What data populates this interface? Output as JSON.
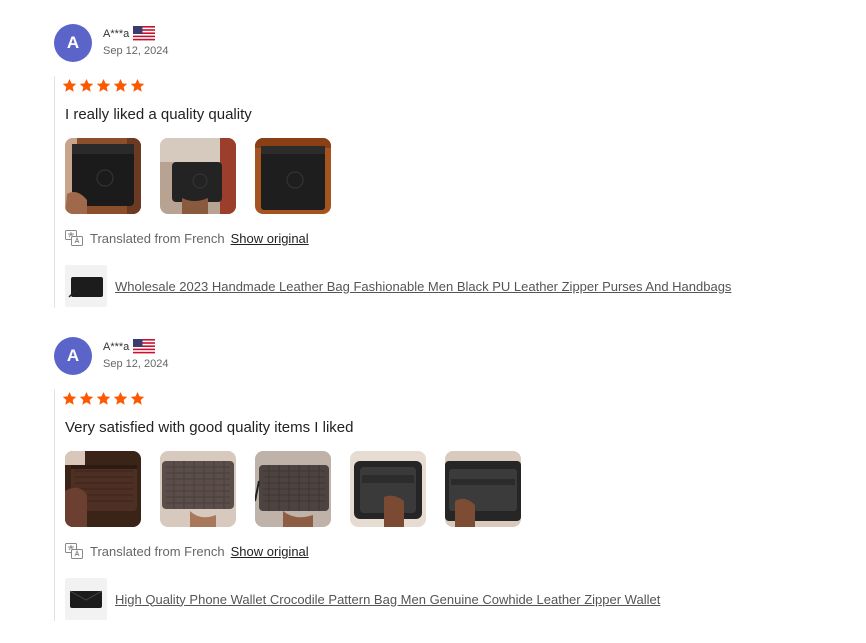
{
  "reviews": [
    {
      "avatar_letter": "A",
      "username": "A***a",
      "date": "Sep 12, 2024",
      "rating": 5,
      "text": "I really liked a quality quality",
      "translated_label": "Translated from French",
      "show_original_label": "Show original",
      "product_title": "Wholesale 2023 Handmade Leather Bag Fashionable Men Black PU Leather Zipper Purses And Handbags",
      "photo_count": 3
    },
    {
      "avatar_letter": "A",
      "username": "A***a",
      "date": "Sep 12, 2024",
      "rating": 5,
      "text": "Very satisfied with good quality items I liked",
      "translated_label": "Translated from French",
      "show_original_label": "Show original",
      "product_title": "High Quality Phone Wallet Crocodile Pattern Bag Men Genuine Cowhide Leather Zipper Wallet",
      "photo_count": 5
    }
  ],
  "colors": {
    "avatar": "#5b64c9",
    "star": "#fd5a00",
    "link": "#555555"
  }
}
